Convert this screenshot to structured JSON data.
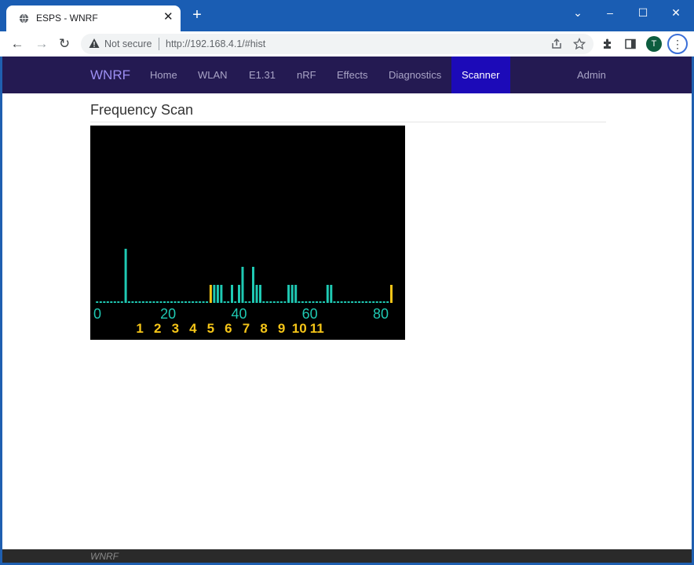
{
  "browser": {
    "tab_title": "ESPS - WNRF",
    "security_label": "Not secure",
    "url": "http://192.168.4.1/#hist",
    "profile_initial": "T"
  },
  "nav": {
    "brand": "WNRF",
    "links": [
      "Home",
      "WLAN",
      "E1.31",
      "nRF",
      "Effects",
      "Diagnostics",
      "Scanner",
      "Admin"
    ],
    "active": "Scanner"
  },
  "page_title": "Frequency Scan",
  "footer_text": "WNRF",
  "colors": {
    "bar": "#1fc9b3",
    "wifi_channel": "#f5c518",
    "nav_bg": "#241a52",
    "nav_active": "#1c0ab8",
    "brand": "#9c8ff2"
  },
  "chart_data": {
    "type": "bar",
    "xlabel": "",
    "ylabel": "",
    "xlim": [
      0,
      84
    ],
    "x_ticks": [
      0,
      20,
      40,
      60,
      80
    ],
    "highlighted_channels": [
      32,
      83
    ],
    "values": [
      0,
      0,
      0,
      0,
      0,
      0,
      0,
      0,
      3,
      0,
      0,
      0,
      0,
      0,
      0,
      0,
      0,
      0,
      0,
      0,
      0,
      0,
      0,
      0,
      0,
      0,
      0,
      0,
      0,
      0,
      0,
      0,
      1,
      1,
      1,
      1,
      0,
      0,
      1,
      0,
      1,
      2,
      0,
      0,
      2,
      1,
      1,
      0,
      0,
      0,
      0,
      0,
      0,
      0,
      1,
      1,
      1,
      0,
      0,
      0,
      0,
      0,
      0,
      0,
      0,
      1,
      1,
      0,
      0,
      0,
      0,
      0,
      0,
      0,
      0,
      0,
      0,
      0,
      0,
      0,
      0,
      0,
      0,
      1
    ],
    "wifi_channels": [
      {
        "label": "1",
        "x": 12
      },
      {
        "label": "2",
        "x": 17
      },
      {
        "label": "3",
        "x": 22
      },
      {
        "label": "4",
        "x": 27
      },
      {
        "label": "5",
        "x": 32
      },
      {
        "label": "6",
        "x": 37
      },
      {
        "label": "7",
        "x": 42
      },
      {
        "label": "8",
        "x": 47
      },
      {
        "label": "9",
        "x": 52
      },
      {
        "label": "10",
        "x": 57
      },
      {
        "label": "11",
        "x": 62
      }
    ]
  }
}
